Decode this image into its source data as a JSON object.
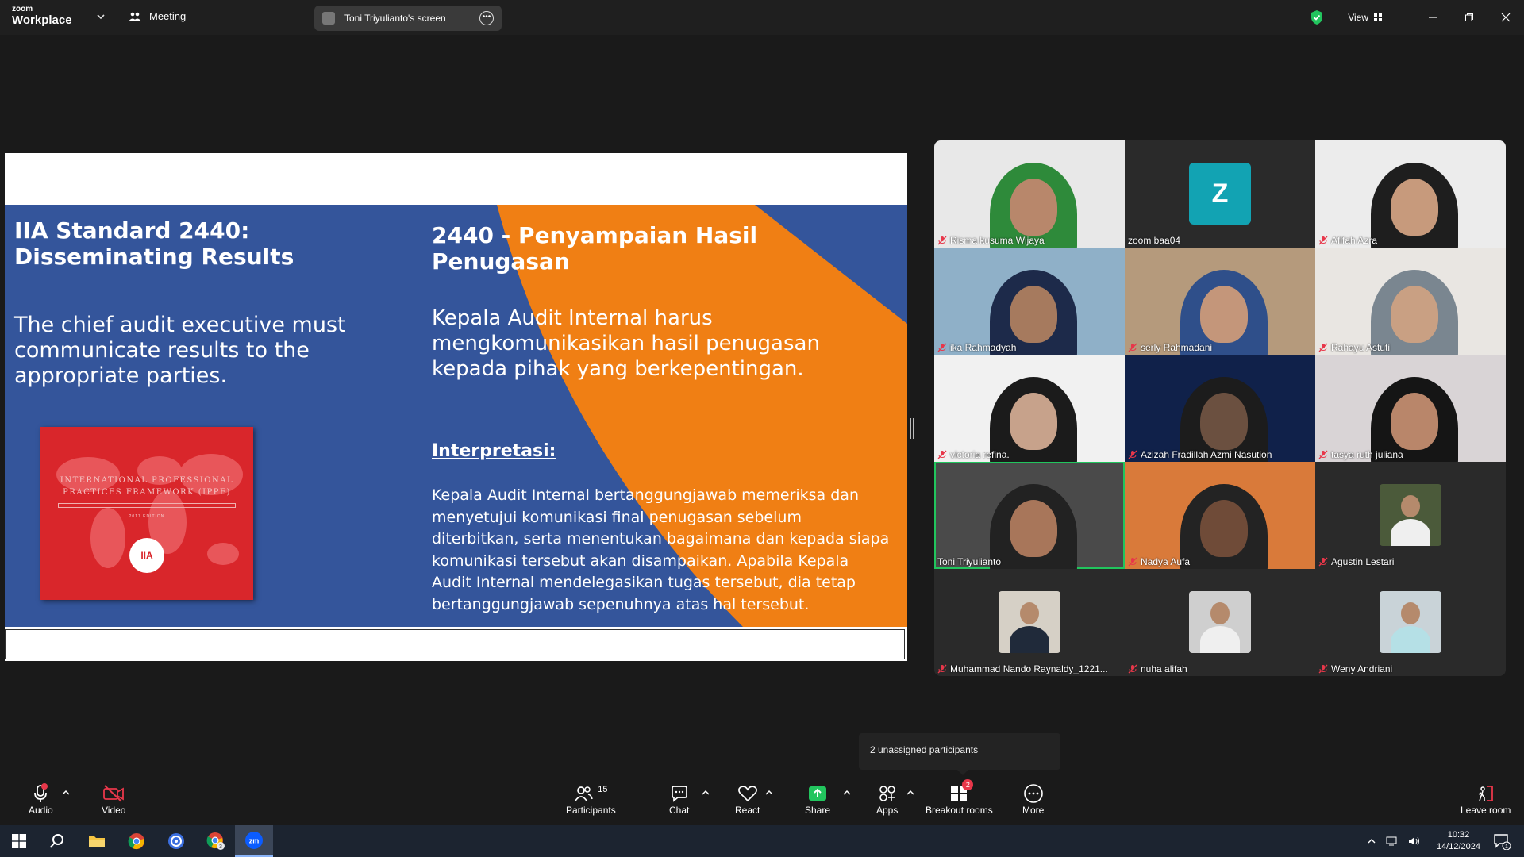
{
  "titlebar": {
    "logo_top": "zoom",
    "logo_bottom": "Workplace",
    "meeting_label": "Meeting",
    "screen_share_label": "Toni Triyulianto's screen",
    "view_label": "View"
  },
  "slide": {
    "title_left": "IIA Standard 2440: Disseminating Results",
    "body_left": "The chief audit executive must communicate results to the appropriate parties.",
    "title_right": "2440 - Penyampaian Hasil Penugasan",
    "body_right": "Kepala Audit Internal harus mengkomunikasikan hasil penugasan kepada pihak yang berkepentingan.",
    "interpretation_heading": "Interpretasi:",
    "interpretation_body": "Kepala Audit Internal bertanggungjawab memeriksa dan menyetujui komunikasi final penugasan sebelum diterbitkan, serta menentukan bagaimana dan kepada siapa komunikasi tersebut akan disampaikan. Apabila Kepala Audit Internal mendelegasikan tugas tersebut, dia tetap bertanggungjawab sepenuhnya atas hal tersebut.",
    "book_title": "INTERNATIONAL PROFESSIONAL PRACTICES FRAMEWORK (IPPF)",
    "book_edition": "2017 EDITION",
    "book_logo": "IIA",
    "colors": {
      "blue": "#34559b",
      "orange": "#f07f14",
      "red": "#d9262b"
    }
  },
  "participants": [
    {
      "name": "Risma kusuma Wijaya",
      "muted": true
    },
    {
      "name": "zoom baa04",
      "muted": false,
      "initial": "Z"
    },
    {
      "name": "Afifah Azra",
      "muted": true
    },
    {
      "name": "ika Rahmadyah",
      "muted": true
    },
    {
      "name": "serly Rahmadani",
      "muted": true
    },
    {
      "name": "Rahayu Astuti",
      "muted": true
    },
    {
      "name": "victoria refina.",
      "muted": true
    },
    {
      "name": "Azizah Fradillah Azmi Nasution",
      "muted": true
    },
    {
      "name": "tasya ruth juliana",
      "muted": true
    },
    {
      "name": "Toni Triyulianto",
      "muted": false,
      "speaking": true
    },
    {
      "name": "Nadya Aufa",
      "muted": true
    },
    {
      "name": "Agustin Lestari",
      "muted": true
    },
    {
      "name": "Muhammad Nando Raynaldy_1221...",
      "muted": true
    },
    {
      "name": "nuha alifah",
      "muted": true
    },
    {
      "name": "Weny Andriani",
      "muted": true
    }
  ],
  "tooltip": "2 unassigned participants",
  "toolbar": {
    "audio": "Audio",
    "video": "Video",
    "participants": "Participants",
    "participants_count": "15",
    "chat": "Chat",
    "react": "React",
    "share": "Share",
    "apps": "Apps",
    "breakout": "Breakout rooms",
    "breakout_badge": "2",
    "more": "More",
    "leave": "Leave room",
    "colors": {
      "share_green": "#22c55e",
      "badge_red": "#e8374a"
    }
  },
  "taskbar": {
    "time": "10:32",
    "date": "14/12/2024",
    "notification_count": "1",
    "chrome_badge": "3"
  }
}
